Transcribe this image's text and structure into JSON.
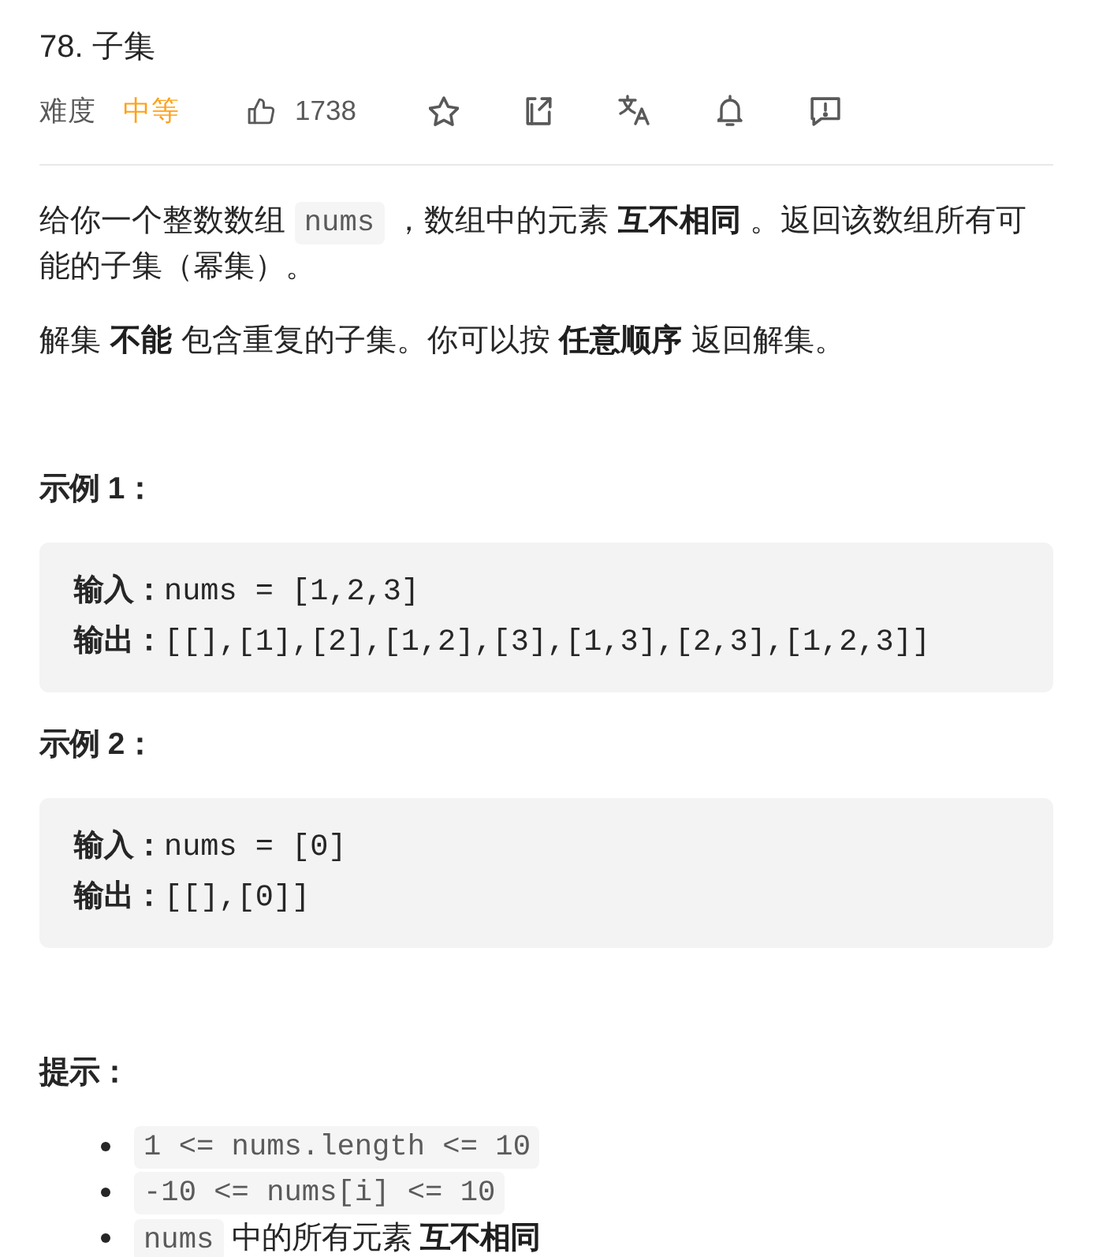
{
  "problem": {
    "title": "78. 子集",
    "difficulty_label": "难度",
    "difficulty": "中等",
    "likes": "1738"
  },
  "description": [
    {
      "segments": [
        {
          "kind": "text",
          "text": "给你一个整数数组 "
        },
        {
          "kind": "code",
          "text": "nums"
        },
        {
          "kind": "text",
          "text": " ，数组中的元素 **互不相同** 。返回该数组所有可能的子集（幂集）。"
        }
      ]
    },
    {
      "segments": [
        {
          "kind": "text",
          "text": "解集 **不能** 包含重复的子集。你可以按 **任意顺序** 返回解集。"
        }
      ]
    }
  ],
  "examples": [
    {
      "title": "示例 1：",
      "lines": [
        "**输入：**nums = [1,2,3]",
        "**输出：**[[],[1],[2],[1,2],[3],[1,3],[2,3],[1,2,3]]"
      ]
    },
    {
      "title": "示例 2：",
      "lines": [
        "**输入：**nums = [0]",
        "**输出：**[[],[0]]"
      ]
    }
  ],
  "hints": {
    "title": "提示：",
    "items": [
      {
        "segments": [
          {
            "kind": "code",
            "text": "1 <= nums.length <= 10"
          }
        ]
      },
      {
        "segments": [
          {
            "kind": "code",
            "text": "-10 <= nums[i] <= 10"
          }
        ]
      },
      {
        "segments": [
          {
            "kind": "code",
            "text": "nums"
          },
          {
            "kind": "text",
            "text": " 中的所有元素 **互不相同**"
          }
        ]
      }
    ]
  }
}
